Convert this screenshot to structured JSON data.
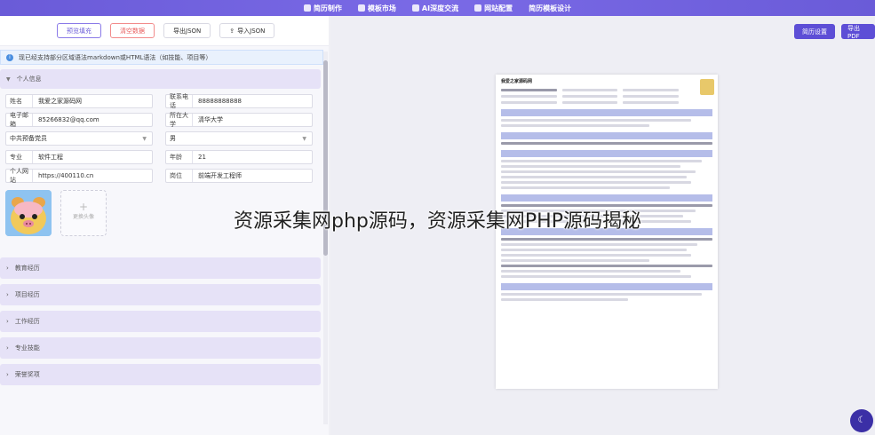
{
  "nav": {
    "items": [
      {
        "label": "简历制作",
        "icon": "resume-icon"
      },
      {
        "label": "模板市场",
        "icon": "template-icon"
      },
      {
        "label": "AI深度交流",
        "icon": "ai-icon"
      },
      {
        "label": "网站配置",
        "icon": "settings-icon"
      },
      {
        "label": "简历模板设计",
        "icon": ""
      }
    ]
  },
  "toolbar": {
    "preview_fill": "预览填充",
    "clear_data": "清空数据",
    "export_json": "导出JSON",
    "import_json": "导入JSON"
  },
  "notice": "现已经支持部分区域语法markdown或HTML语法（如技能、项目等）",
  "personal": {
    "section_title": "个人信息",
    "fields": {
      "name": {
        "label": "姓名",
        "value": "我爱之家源码网"
      },
      "phone": {
        "label": "联系电话",
        "value": "88888888888"
      },
      "email": {
        "label": "电子邮箱",
        "value": "85266832@qq.com"
      },
      "school": {
        "label": "所在大学",
        "value": "清华大学"
      },
      "politics": {
        "label": "",
        "value": "中共预备党员"
      },
      "gender": {
        "label": "",
        "value": "男"
      },
      "major": {
        "label": "专业",
        "value": "软件工程"
      },
      "age": {
        "label": "年龄",
        "value": "21"
      },
      "website": {
        "label": "个人网站",
        "value": "https://400110.cn"
      },
      "position": {
        "label": "岗位",
        "value": "前端开发工程师"
      }
    },
    "upload_label": "更换头像"
  },
  "sections": [
    "教育经历",
    "项目经历",
    "工作经历",
    "专业技能",
    "荣誉奖项"
  ],
  "right": {
    "resume_settings": "简历设置",
    "export_pdf": "导出PDF"
  },
  "overlay_title": "资源采集网php源码，资源采集网PHP源码揭秘",
  "colors": {
    "accent": "#6a5bd8",
    "section_bg": "#e6e2f7"
  }
}
